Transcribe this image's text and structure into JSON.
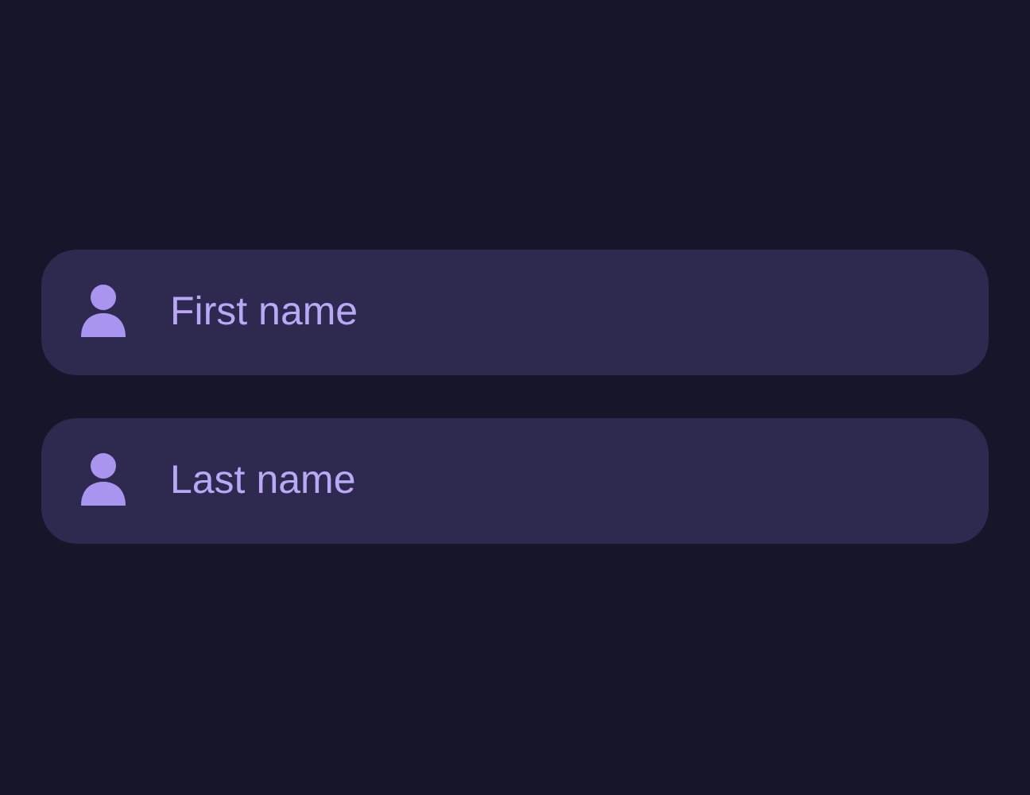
{
  "fields": [
    {
      "placeholder": "First name"
    },
    {
      "placeholder": "Last name"
    }
  ]
}
